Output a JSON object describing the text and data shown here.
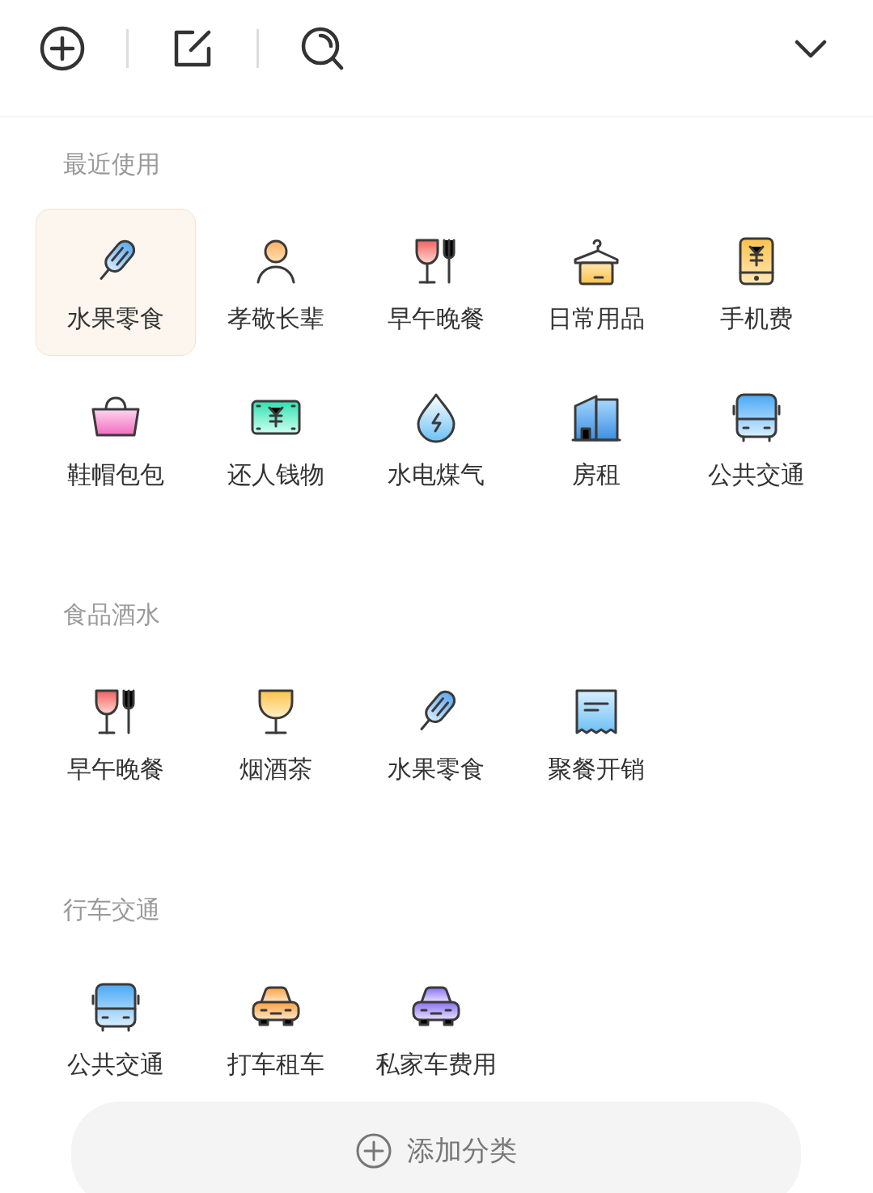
{
  "sections": [
    {
      "title": "最近使用",
      "items": [
        {
          "label": "水果零食",
          "kind": "popsicle",
          "selected": true
        },
        {
          "label": "孝敬长辈",
          "kind": "person",
          "selected": false
        },
        {
          "label": "早午晚餐",
          "kind": "dining",
          "selected": false
        },
        {
          "label": "日常用品",
          "kind": "hanger",
          "selected": false
        },
        {
          "label": "手机费",
          "kind": "phone",
          "selected": false
        },
        {
          "label": "鞋帽包包",
          "kind": "bag",
          "selected": false
        },
        {
          "label": "还人钱物",
          "kind": "cash",
          "selected": false
        },
        {
          "label": "水电煤气",
          "kind": "drop",
          "selected": false
        },
        {
          "label": "房租",
          "kind": "building",
          "selected": false
        },
        {
          "label": "公共交通",
          "kind": "bus",
          "selected": false
        }
      ]
    },
    {
      "title": "食品酒水",
      "items": [
        {
          "label": "早午晚餐",
          "kind": "dining",
          "selected": false
        },
        {
          "label": "烟酒茶",
          "kind": "glass",
          "selected": false
        },
        {
          "label": "水果零食",
          "kind": "popsicle",
          "selected": false
        },
        {
          "label": "聚餐开销",
          "kind": "receipt",
          "selected": false
        }
      ]
    },
    {
      "title": "行车交通",
      "items": [
        {
          "label": "公共交通",
          "kind": "bus",
          "selected": false
        },
        {
          "label": "打车租车",
          "kind": "taxi",
          "selected": false
        },
        {
          "label": "私家车费用",
          "kind": "car",
          "selected": false
        }
      ]
    }
  ],
  "add_button": {
    "label": "添加分类"
  }
}
